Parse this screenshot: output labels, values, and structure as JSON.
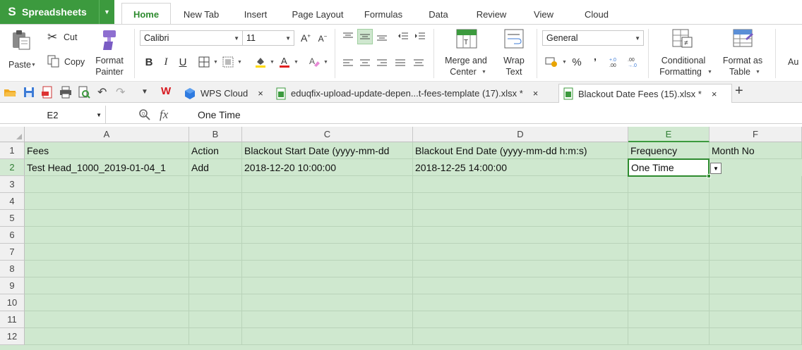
{
  "app": {
    "name": "Spreadsheets"
  },
  "menu": {
    "tabs": [
      "Home",
      "New Tab",
      "Insert",
      "Page Layout",
      "Formulas",
      "Data",
      "Review",
      "View",
      "Cloud"
    ],
    "active": "Home"
  },
  "ribbon": {
    "paste": "Paste",
    "cut": "Cut",
    "copy": "Copy",
    "format_painter_1": "Format",
    "format_painter_2": "Painter",
    "font_name": "Calibri",
    "font_size": "11",
    "merge_1": "Merge and",
    "merge_2": "Center",
    "wrap_1": "Wrap",
    "wrap_2": "Text",
    "number_format": "General",
    "percent": "%",
    "comma": "’",
    "cond_1": "Conditional",
    "cond_2": "Formatting",
    "fmt_table_1": "Format as",
    "fmt_table_2": "Table",
    "autosum_partial": "Au"
  },
  "doc_tabs": {
    "wps_cloud": "WPS Cloud",
    "file1": "eduqfix-upload-update-depen...t-fees-template (17).xlsx *",
    "file2": "Blackout Date Fees (15).xlsx *",
    "close": "×",
    "add": "+"
  },
  "formula_bar": {
    "cell_ref": "E2",
    "fx": "fx",
    "value": "One Time"
  },
  "sheet": {
    "columns": [
      "A",
      "B",
      "C",
      "D",
      "E",
      "F"
    ],
    "rows": [
      "1",
      "2",
      "3",
      "4",
      "5",
      "6",
      "7",
      "8",
      "9",
      "10",
      "11",
      "12"
    ],
    "cells": {
      "A1": "Fees",
      "B1": "Action",
      "C1": "Blackout Start Date (yyyy-mm-dd",
      "D1": "Blackout End Date (yyyy-mm-dd h:m:s)",
      "E1": "Frequency",
      "F1": "Month No",
      "A2": "Test Head_1000_2019-01-04_1",
      "B2": "Add",
      "C2": "2018-12-20 10:00:00",
      "D2": "2018-12-25 14:00:00",
      "E2": "One Time"
    }
  },
  "colors": {
    "accent": "#3c9a3e",
    "sheet_bg": "#cfe8cf",
    "selection": "#2e8b2f"
  }
}
